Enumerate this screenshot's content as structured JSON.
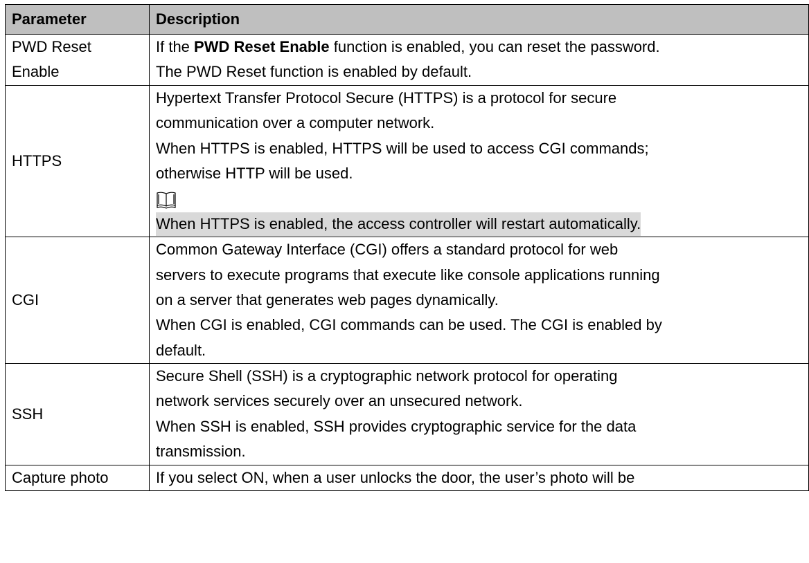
{
  "table": {
    "headers": {
      "parameter": "Parameter",
      "description": "Description"
    },
    "rows": {
      "pwd_reset": {
        "param_line1": "PWD Reset",
        "param_line2": "Enable",
        "desc_prefix": "If the ",
        "desc_bold": "PWD Reset Enable",
        "desc_suffix": " function is enabled, you can reset the password.",
        "desc_line2": "The PWD Reset function is enabled by default."
      },
      "https": {
        "param": "HTTPS",
        "desc_line1": "Hypertext Transfer Protocol Secure (HTTPS) is a protocol for secure",
        "desc_line2": "communication over a computer network.",
        "desc_line3": "When HTTPS is enabled, HTTPS will be used to access CGI commands;",
        "desc_line4": "otherwise HTTP will be used.",
        "note_icon": "book-note-icon",
        "note": "When HTTPS is enabled, the access controller will restart automatically."
      },
      "cgi": {
        "param": "CGI",
        "desc_line1": "Common Gateway Interface (CGI) offers a standard protocol for web",
        "desc_line2": "servers to execute programs that execute like console applications running",
        "desc_line3": "on a server that generates web pages dynamically.",
        "desc_line4": "When CGI is enabled, CGI commands can be used. The CGI is enabled by",
        "desc_line5": "default."
      },
      "ssh": {
        "param": "SSH",
        "desc_line1": "Secure Shell (SSH) is a cryptographic network protocol for operating",
        "desc_line2": "network services securely over an unsecured network.",
        "desc_line3": "When SSH is enabled, SSH provides cryptographic service for the data",
        "desc_line4": "transmission."
      },
      "capture_photo": {
        "param": "Capture photo",
        "desc_line1": "If you select ON, when a user unlocks the door, the user’s photo will be"
      }
    }
  },
  "colors": {
    "header_bg": "#bfbfbf",
    "note_highlight": "#d9d9d9",
    "border": "#000000"
  }
}
